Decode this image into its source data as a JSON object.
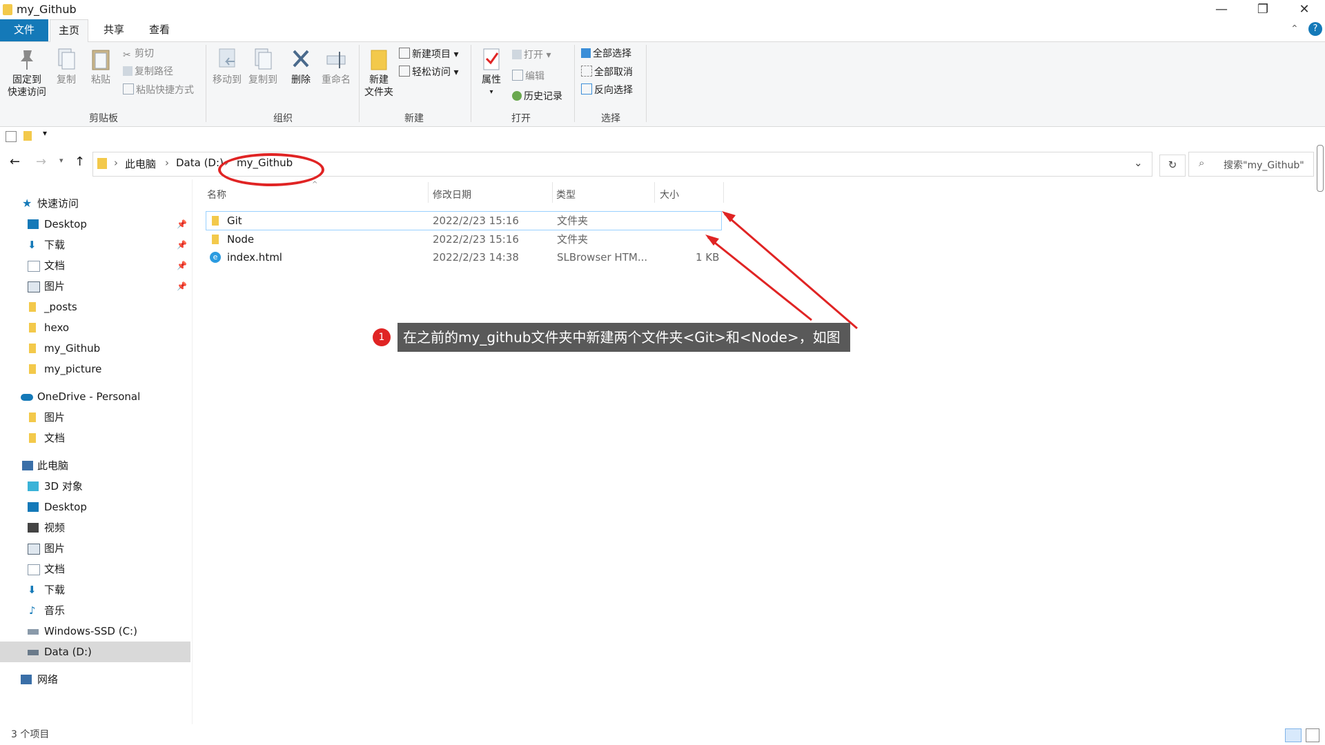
{
  "window": {
    "title": "my_Github"
  },
  "ribbon_tabs": [
    "文件",
    "主页",
    "共享",
    "查看"
  ],
  "ribbon": {
    "pin_line1": "固定到",
    "pin_line2": "快速访问",
    "copy": "复制",
    "paste": "粘贴",
    "cut": "剪切",
    "copy_path": "复制路径",
    "paste_shortcut": "粘贴快捷方式",
    "group_clipboard": "剪贴板",
    "move_to": "移动到",
    "copy_to": "复制到",
    "delete": "删除",
    "rename": "重命名",
    "group_organize": "组织",
    "new_folder_line1": "新建",
    "new_folder_line2": "文件夹",
    "new_item": "新建项目",
    "easy_access": "轻松访问",
    "group_new": "新建",
    "properties": "属性",
    "open": "打开",
    "edit": "编辑",
    "history": "历史记录",
    "group_open": "打开",
    "select_all": "全部选择",
    "select_none": "全部取消",
    "invert": "反向选择",
    "group_select": "选择"
  },
  "address": {
    "seg1": "此电脑",
    "seg2": "Data (D:)",
    "seg3": "my_Github",
    "search_placeholder": "搜索\"my_Github\""
  },
  "nav": {
    "quick_access": "快速访问",
    "items": [
      "Desktop",
      "下载",
      "文档",
      "图片",
      "_posts",
      "hexo",
      "my_Github",
      "my_picture"
    ],
    "onedrive": "OneDrive - Personal",
    "onedrive_items": [
      "图片",
      "文档"
    ],
    "this_pc": "此电脑",
    "pc_items": [
      "3D 对象",
      "Desktop",
      "视频",
      "图片",
      "文档",
      "下载",
      "音乐",
      "Windows-SSD (C:)",
      "Data (D:)"
    ],
    "network": "网络"
  },
  "columns": {
    "name": "名称",
    "modified": "修改日期",
    "type": "类型",
    "size": "大小"
  },
  "files": [
    {
      "name": "Git",
      "modified": "2022/2/23 15:16",
      "type": "文件夹",
      "size": ""
    },
    {
      "name": "Node",
      "modified": "2022/2/23 15:16",
      "type": "文件夹",
      "size": ""
    },
    {
      "name": "index.html",
      "modified": "2022/2/23 14:38",
      "type": "SLBrowser HTM...",
      "size": "1 KB"
    }
  ],
  "status": {
    "count": "3 个项目"
  },
  "annotation": {
    "number": "1",
    "text": "在之前的my_github文件夹中新建两个文件夹<Git>和<Node>，如图"
  },
  "colors": {
    "accent": "#1479b8",
    "annotation_red": "#e02424",
    "folder": "#f3c94b"
  }
}
